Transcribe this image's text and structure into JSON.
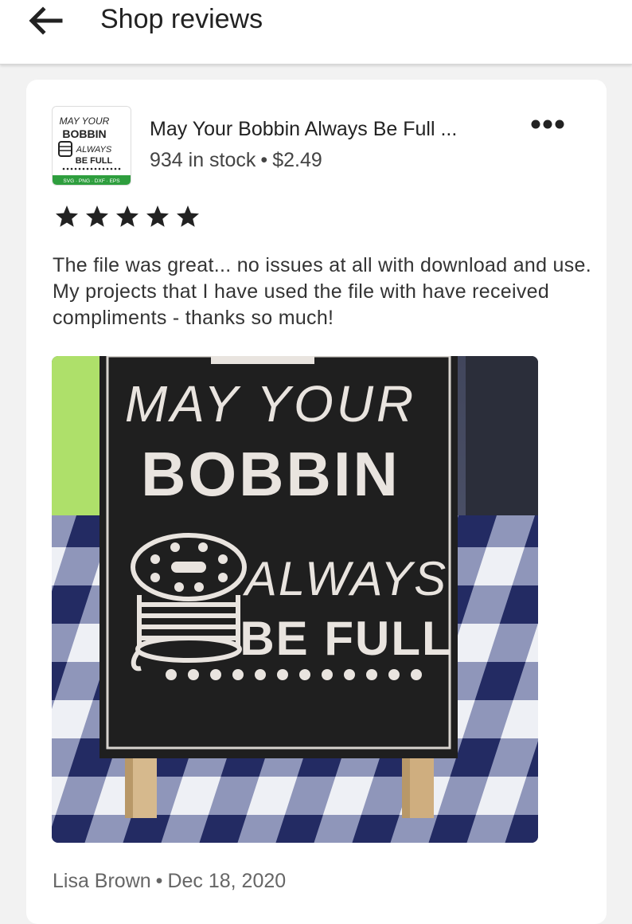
{
  "header": {
    "title": "Shop reviews",
    "back_icon": "back-arrow-icon"
  },
  "review": {
    "listing": {
      "title": "May Your Bobbin Always Be Full ...",
      "stock": "934 in stock",
      "separator": "•",
      "price": "$2.49",
      "thumbnail": {
        "lines": [
          "MAY YOUR",
          "BOBBIN",
          "ALWAYS",
          "BE FULL"
        ],
        "footer": "SVG · PNG · DXF · EPS"
      }
    },
    "more_icon": "more-dots-icon",
    "rating": 5,
    "rating_icon": "star-icon",
    "text": "The file was great... no issues at all with download and use. My projects that I have used the file with have received compliments - thanks so much!",
    "photo": {
      "lines": [
        "MAY YOUR",
        "BOBBIN",
        "ALWAYS",
        "BE FULL"
      ]
    },
    "author": "Lisa Brown",
    "date": "Dec 18, 2020"
  },
  "colors": {
    "background": "#f2f2f2",
    "card": "#ffffff",
    "text": "#222222",
    "muted": "#666666",
    "chalkboard": "#1f1f1f",
    "vinyl": "#e9e4df",
    "badge_green": "#2e9e3e"
  }
}
